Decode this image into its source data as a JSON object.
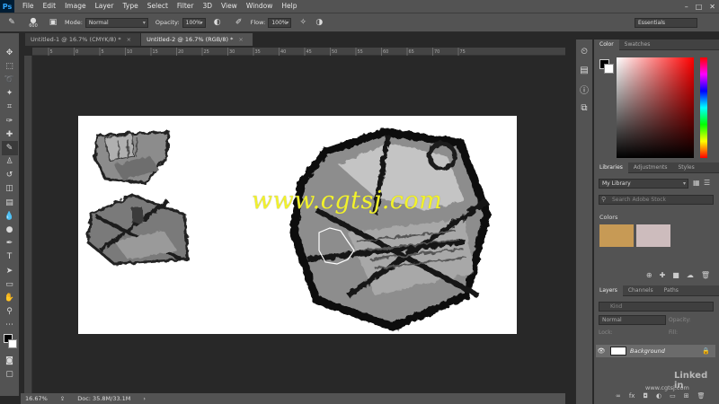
{
  "app": {
    "logo": "Ps"
  },
  "menu": [
    "File",
    "Edit",
    "Image",
    "Layer",
    "Type",
    "Select",
    "Filter",
    "3D",
    "View",
    "Window",
    "Help"
  ],
  "options": {
    "brush_size": "600",
    "mode_label": "Mode:",
    "mode_value": "Normal",
    "opacity_label": "Opacity:",
    "opacity_value": "100%",
    "flow_label": "Flow:",
    "flow_value": "100%",
    "workspace": "Essentials"
  },
  "tabs": [
    {
      "label": "Untitled-1 @ 16.7% (CMYK/8) *"
    },
    {
      "label": "Untitled-2 @ 16.7% (RGB/8) *"
    }
  ],
  "ruler_ticks": [
    "5",
    "0",
    "5",
    "10",
    "15",
    "20",
    "25",
    "30",
    "35",
    "40",
    "45",
    "50",
    "55",
    "60",
    "65",
    "70",
    "75"
  ],
  "canvas": {
    "watermark": "www.cgtsj.com"
  },
  "status": {
    "zoom": "16.67%",
    "doc": "Doc: 35.8M/33.1M"
  },
  "panels": {
    "color": {
      "tabs": [
        "Color",
        "Swatches"
      ]
    },
    "libraries": {
      "tabs": [
        "Libraries",
        "Adjustments",
        "Styles"
      ],
      "library_name": "My Library",
      "search_placeholder": "Search Adobe Stock",
      "colors_heading": "Colors",
      "swatches": [
        "#c79a55",
        "#cdbcbd"
      ]
    },
    "layers": {
      "tabs": [
        "Layers",
        "Channels",
        "Paths"
      ],
      "kind_placeholder": "Kind",
      "blend_mode": "Normal",
      "opacity_label": "Opacity:",
      "lock_label": "Lock:",
      "fill_label": "Fill:",
      "layer_name": "Background"
    }
  },
  "branding": {
    "logo": "Linked in",
    "site": "www.cgtsj.com"
  }
}
